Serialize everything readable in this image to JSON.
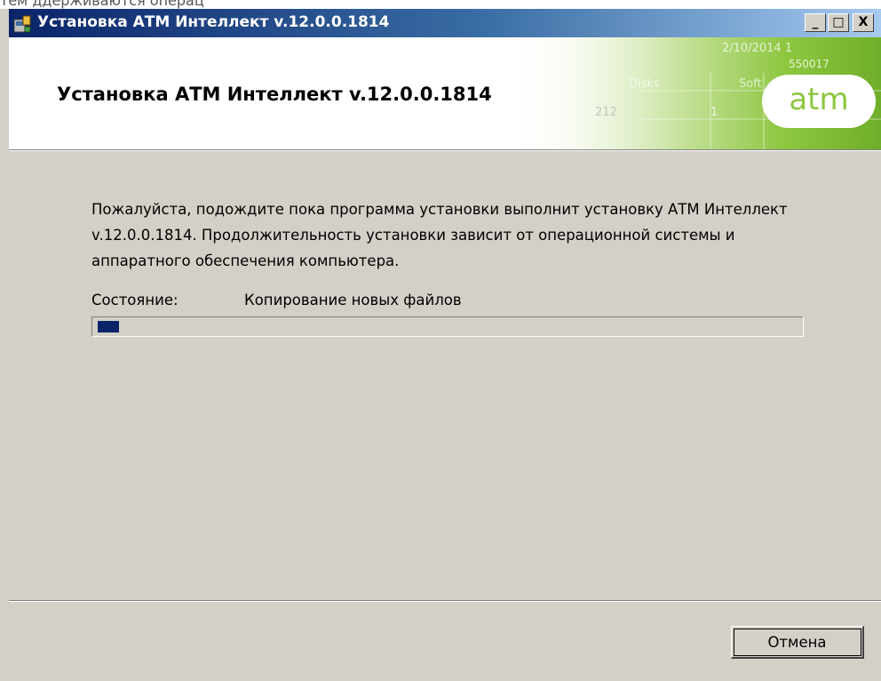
{
  "background_text": "тем ддерживаются операц",
  "window": {
    "title": "Установка АТМ Интеллект v.12.0.0.1814",
    "controls": {
      "minimize": "_",
      "maximize": "□",
      "close": "X"
    }
  },
  "header": {
    "title": "Установка АТМ Интеллект v.12.0.0.1814",
    "logo_text": "atm",
    "decor": {
      "date": "2/10/2014 1",
      "code": "550017",
      "col_disks": "Disks",
      "col_soft": "Soft",
      "cell_a": "212",
      "cell_b": "1"
    }
  },
  "body": {
    "description": "Пожалуйста, подождите пока программа установки выполнит установку АТМ Интеллект v.12.0.0.1814. Продолжительность установки зависит от операционной системы и аппаратного обеспечения компьютера.",
    "status_label": "Состояние:",
    "status_value": "Копирование новых файлов",
    "progress_fraction": 0.03
  },
  "footer": {
    "cancel_label": "Отмена"
  },
  "colors": {
    "titlebar_start": "#0a246a",
    "titlebar_end": "#a6caf0",
    "dialog_bg": "#d4d0c8",
    "progress_fill": "#0a246a",
    "logo_green": "#8dc63f"
  }
}
